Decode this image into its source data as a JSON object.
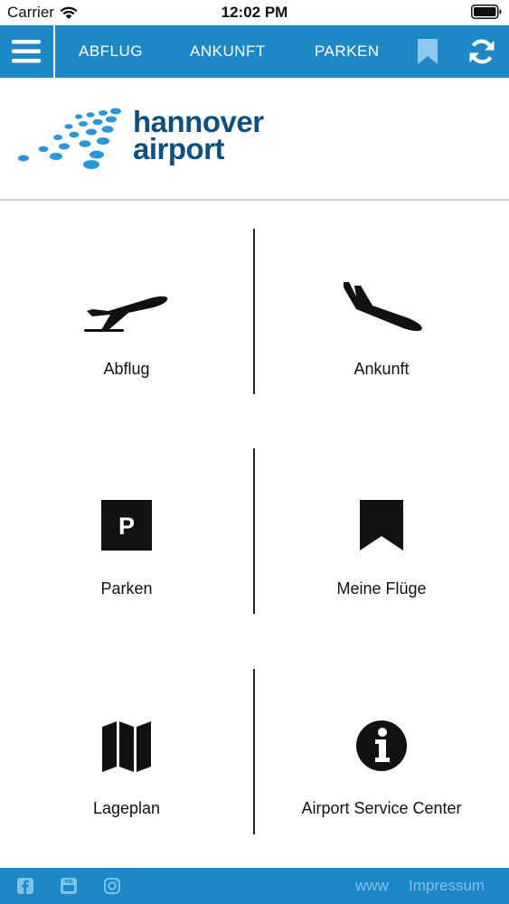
{
  "status_bar": {
    "carrier": "Carrier",
    "time": "12:02 PM"
  },
  "nav": {
    "tabs": [
      {
        "label": "ABFLUG"
      },
      {
        "label": "ANKUNFT"
      },
      {
        "label": "PARKEN"
      }
    ],
    "icons": [
      "menu-icon",
      "bookmark-icon",
      "refresh-icon"
    ]
  },
  "logo": {
    "line1": "hannover",
    "line2": "airport"
  },
  "tiles": [
    {
      "label": "Abflug",
      "icon": "departure-plane-icon"
    },
    {
      "label": "Ankunft",
      "icon": "arrival-plane-icon"
    },
    {
      "label": "Parken",
      "icon": "parking-icon",
      "icon_text": "P"
    },
    {
      "label": "Meine Flüge",
      "icon": "bookmark-icon"
    },
    {
      "label": "Lageplan",
      "icon": "map-icon"
    },
    {
      "label": "Airport Service Center",
      "icon": "info-icon"
    }
  ],
  "footer": {
    "icons": [
      "facebook-icon",
      "youtube-icon",
      "instagram-icon"
    ],
    "links": [
      {
        "label": "www"
      },
      {
        "label": "Impressum"
      }
    ]
  },
  "colors": {
    "brand_blue": "#1e87c8",
    "logo_navy": "#0e4f7f",
    "logo_dots": "#2a95d8"
  }
}
